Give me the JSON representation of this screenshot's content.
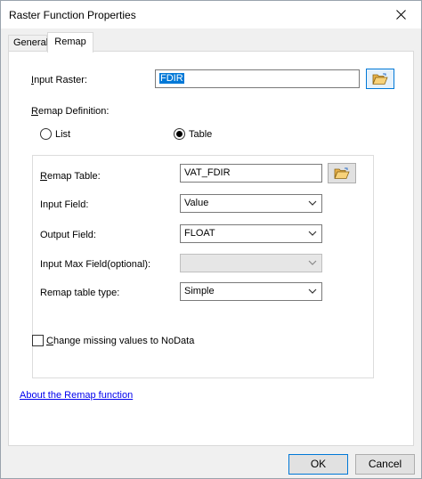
{
  "window": {
    "title": "Raster Function Properties"
  },
  "tabs": [
    {
      "label": "General"
    },
    {
      "label": "Remap"
    }
  ],
  "input_raster": {
    "label": "Input Raster:",
    "value": "FDIR"
  },
  "remap_definition": {
    "label": "Remap Definition:",
    "option_list": "List",
    "option_table": "Table",
    "selected": "Table"
  },
  "group": {
    "remap_table_label": "Remap Table:",
    "remap_table_value": "VAT_FDIR",
    "input_field_label": "Input Field:",
    "input_field_value": "Value",
    "output_field_label": "Output Field:",
    "output_field_value": "FLOAT",
    "input_max_field_label": "Input Max Field(optional):",
    "input_max_field_value": "",
    "remap_type_label": "Remap table type:",
    "remap_type_value": "Simple"
  },
  "nodata_checkbox": {
    "label": "Change missing values to NoData",
    "checked": false
  },
  "help_link": "About the Remap function",
  "buttons": {
    "ok": "OK",
    "cancel": "Cancel"
  },
  "icons": {
    "close": "close-icon",
    "folder": "open-folder-icon",
    "chevron": "chevron-down-icon"
  }
}
